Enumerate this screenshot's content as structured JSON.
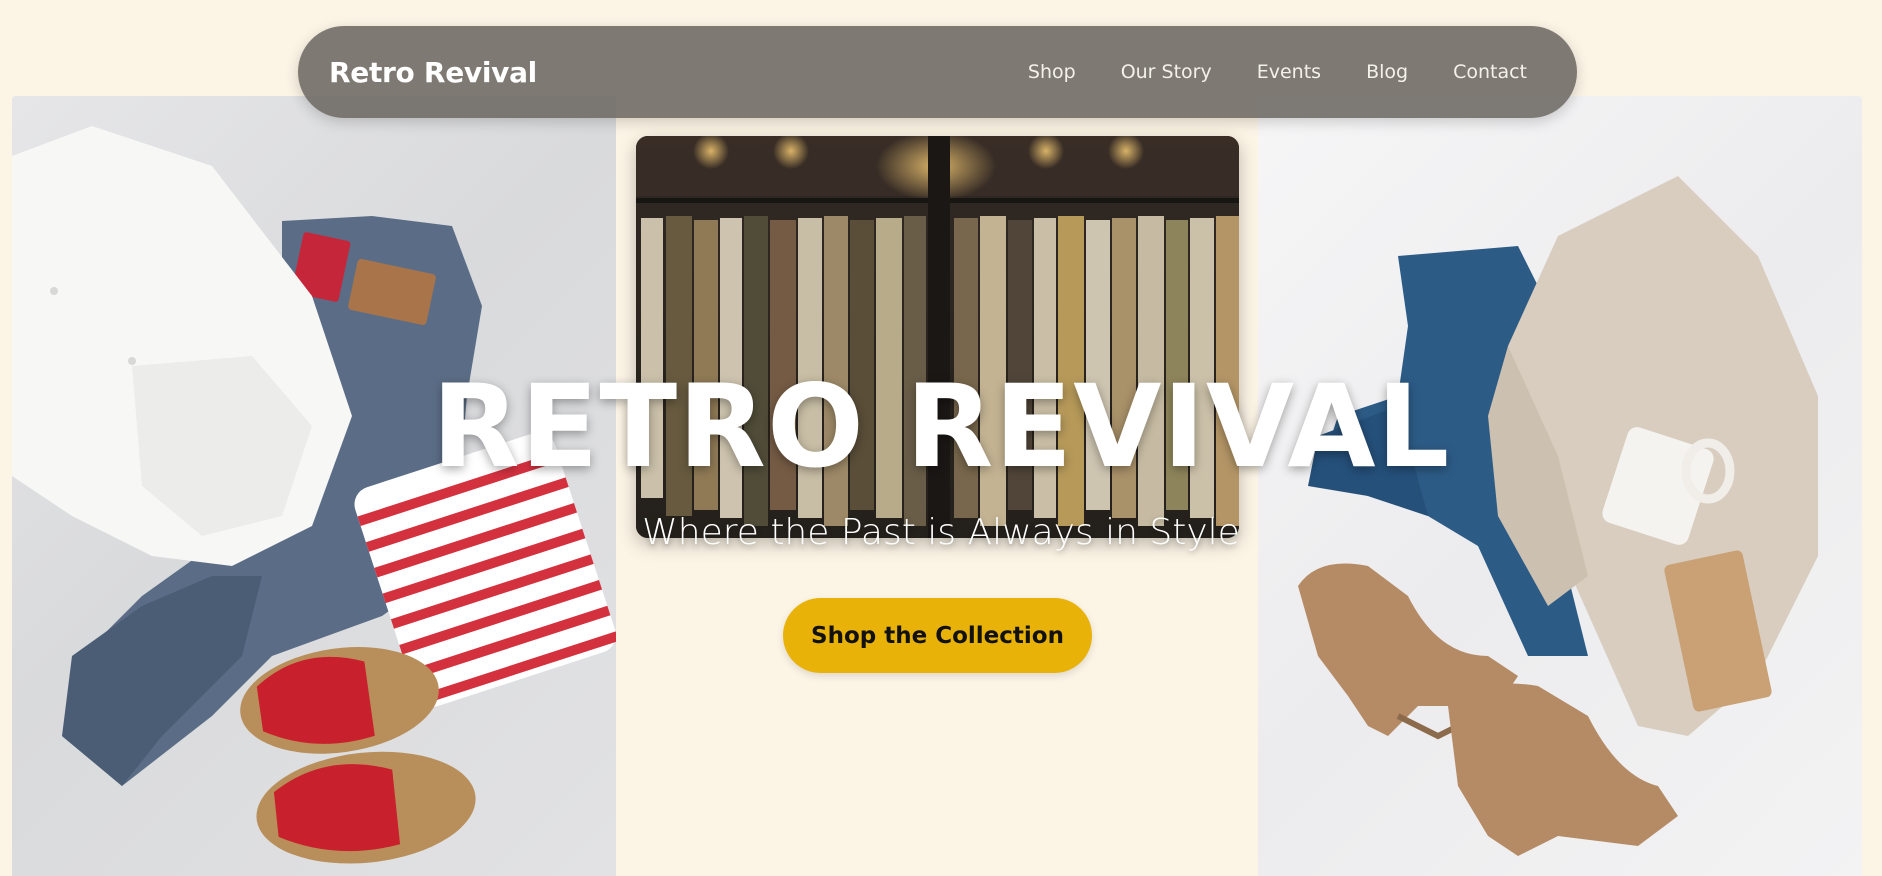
{
  "nav": {
    "brand": "Retro Revival",
    "links": [
      {
        "label": "Shop"
      },
      {
        "label": "Our Story"
      },
      {
        "label": "Events"
      },
      {
        "label": "Blog"
      },
      {
        "label": "Contact"
      }
    ]
  },
  "hero": {
    "title": "RETRO REVIVAL",
    "subtitle": "Where the Past is Always in Style",
    "cta_label": "Shop the Collection"
  },
  "images": {
    "left": "flat-lay-white-shirt-jeans-striped-top-red-sandals",
    "center": "vintage-clothing-rack-store-interior",
    "right": "flat-lay-jeans-knit-cardigan-suede-boots-mug"
  },
  "colors": {
    "background": "#fcf4e5",
    "nav_background": "#6c6862",
    "accent": "#e8b208",
    "hero_text": "#ffffff"
  }
}
